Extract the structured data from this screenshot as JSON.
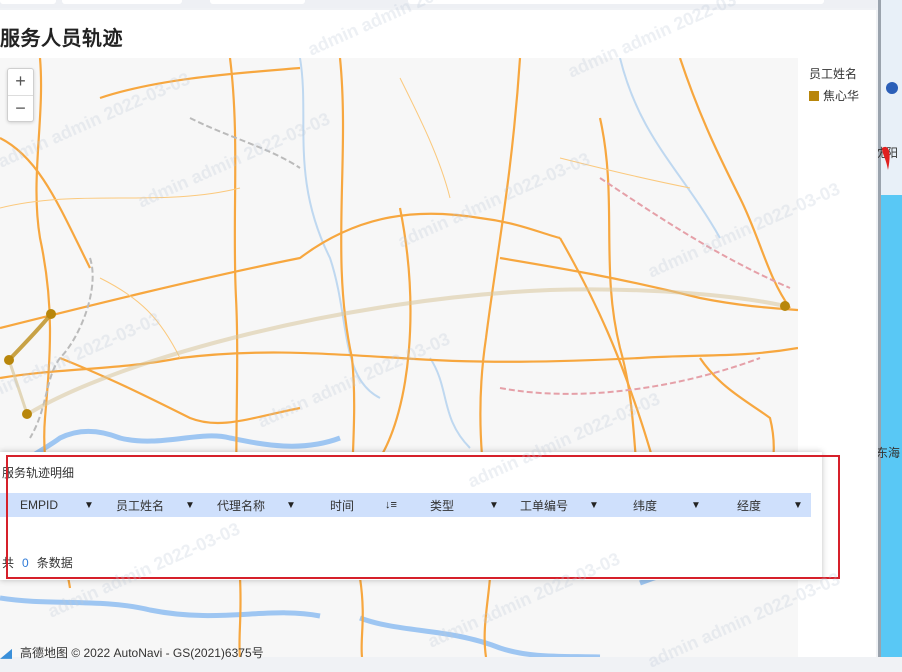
{
  "page": {
    "title": "服务人员轨迹",
    "watermark": "admin admin 2022-03-03"
  },
  "map": {
    "zoom_in": "+",
    "zoom_out": "−",
    "attribution": "高德地图 © 2022 AutoNavi - GS(2021)6375号",
    "track_color": "#b8860b"
  },
  "legend": {
    "title": "员工姓名",
    "items": [
      {
        "label": "焦心华",
        "color": "#b8860b"
      }
    ]
  },
  "right_panel": {
    "city_label": "沈阳",
    "sea_label": "东海"
  },
  "detail_panel": {
    "title": "服务轨迹明细",
    "columns": [
      {
        "label": "EMPID",
        "control": "filter-icon"
      },
      {
        "label": "员工姓名",
        "control": "dropdown-icon"
      },
      {
        "label": "代理名称",
        "control": "dropdown-icon"
      },
      {
        "label": "时间",
        "control": "sort-icon"
      },
      {
        "label": "类型",
        "control": "dropdown-icon"
      },
      {
        "label": "工单编号",
        "control": "dropdown-icon"
      },
      {
        "label": "纬度",
        "control": "dropdown-icon"
      },
      {
        "label": "经度",
        "control": "dropdown-icon"
      }
    ],
    "rows": [],
    "footer": {
      "prefix": "共",
      "count": "0",
      "suffix": "条数据"
    }
  }
}
